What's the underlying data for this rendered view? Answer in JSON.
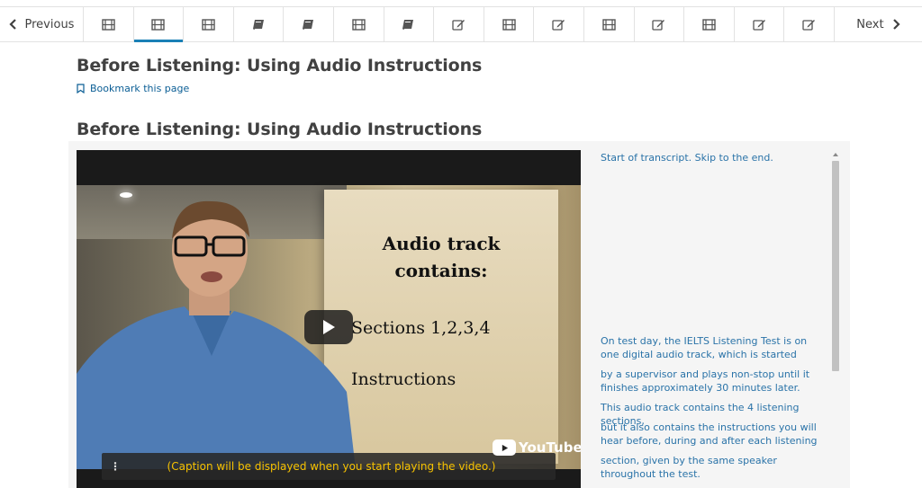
{
  "nav": {
    "previous_label": "Previous",
    "next_label": "Next",
    "tabs": [
      {
        "icon": "film-icon",
        "active": false
      },
      {
        "icon": "film-icon",
        "active": true
      },
      {
        "icon": "film-icon",
        "active": false
      },
      {
        "icon": "book-icon",
        "active": false
      },
      {
        "icon": "book-icon",
        "active": false
      },
      {
        "icon": "film-icon",
        "active": false
      },
      {
        "icon": "book-icon",
        "active": false
      },
      {
        "icon": "edit-icon",
        "active": false
      },
      {
        "icon": "film-icon",
        "active": false
      },
      {
        "icon": "edit-icon",
        "active": false
      },
      {
        "icon": "film-icon",
        "active": false
      },
      {
        "icon": "edit-icon",
        "active": false
      },
      {
        "icon": "film-icon",
        "active": false
      },
      {
        "icon": "edit-icon",
        "active": false
      },
      {
        "icon": "edit-icon",
        "active": false
      }
    ]
  },
  "page": {
    "title": "Before Listening: Using Audio Instructions",
    "bookmark_label": "Bookmark this page",
    "section_title": "Before Listening: Using Audio Instructions"
  },
  "video": {
    "board_title_1": "Audio track",
    "board_title_2": "contains:",
    "board_item_1": "Sections 1,2,3,4",
    "board_item_2": "Instructions",
    "caption_text": "(Caption will be displayed when you start playing the video.)",
    "caption_menu": "⋮",
    "youtube_text": "YouTube"
  },
  "transcript": {
    "skip_text": "Start of transcript. Skip to the end.",
    "lines": [
      "On test day, the IELTS Listening Test is on one digital audio track, which is started",
      "by a supervisor and plays non-stop until it finishes approximately 30 minutes later.",
      "This audio track contains the 4 listening sections,",
      "but it also contains the instructions you will hear before, during and after each listening",
      "section, given by the same speaker throughout the test."
    ]
  },
  "colors": {
    "accent": "#1a80b6",
    "link": "#2a73a8",
    "caption": "#f7c200"
  }
}
